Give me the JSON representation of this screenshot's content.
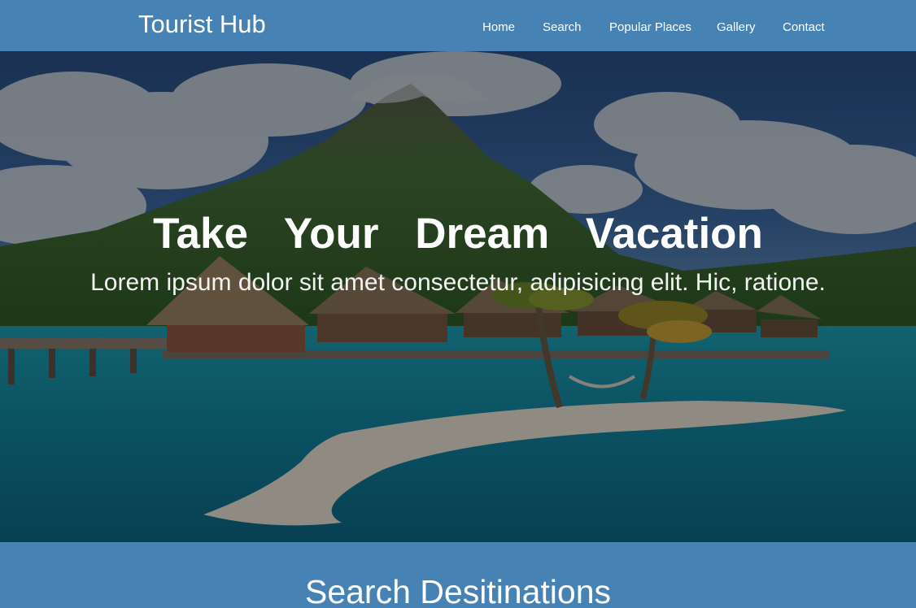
{
  "brand": "Tourist Hub",
  "nav": [
    {
      "label": "Home"
    },
    {
      "label": "Search"
    },
    {
      "label": "Popular Places"
    },
    {
      "label": "Gallery"
    },
    {
      "label": "Contact"
    }
  ],
  "hero": {
    "title": "Take Your Dream Vacation",
    "subtitle": "Lorem ipsum dolor sit amet consectetur, adipisicing elit. Hic, ratione."
  },
  "search_section": {
    "heading": "Search Desitinations"
  },
  "colors": {
    "primary": "#4682b4",
    "text": "#ffffff"
  }
}
